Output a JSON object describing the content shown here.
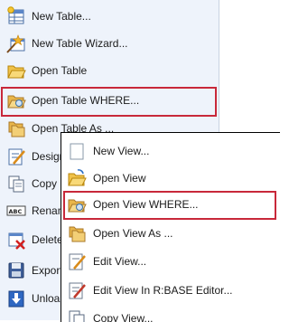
{
  "main_menu": {
    "items": [
      {
        "label": "New Table...",
        "icon": "new-table-icon"
      },
      {
        "label": "New Table Wizard...",
        "icon": "wizard-icon"
      },
      {
        "label": "Open Table",
        "icon": "folder-open-icon"
      },
      {
        "label": "Open Table WHERE...",
        "icon": "folder-open-where-icon",
        "highlighted": true
      },
      {
        "label": "Open Table As ...",
        "icon": "open-as-icon"
      },
      {
        "label": "Design",
        "icon": "design-icon"
      },
      {
        "label": "Copy",
        "icon": "copy-icon"
      },
      {
        "label": "Renam",
        "icon": "rename-icon"
      },
      {
        "label": "Delete",
        "icon": "delete-icon"
      },
      {
        "label": "Export",
        "icon": "export-icon"
      },
      {
        "label": "Unloa",
        "icon": "unload-icon"
      }
    ]
  },
  "submenu": {
    "items": [
      {
        "label": "New View...",
        "icon": "new-view-icon"
      },
      {
        "label": "Open View",
        "icon": "folder-open-icon"
      },
      {
        "label": "Open View WHERE...",
        "icon": "folder-open-where-icon",
        "highlighted": true
      },
      {
        "label": "Open View As ...",
        "icon": "open-as-icon"
      },
      {
        "label": "Edit View...",
        "icon": "edit-icon"
      },
      {
        "label": "Edit View In R:BASE Editor...",
        "icon": "edit-editor-icon"
      },
      {
        "label": "Copy View...",
        "icon": "copy-icon"
      }
    ]
  },
  "colors": {
    "highlight_border": "#c8283a",
    "menu_background": "#eef3fb",
    "submenu_background": "#ffffff"
  }
}
